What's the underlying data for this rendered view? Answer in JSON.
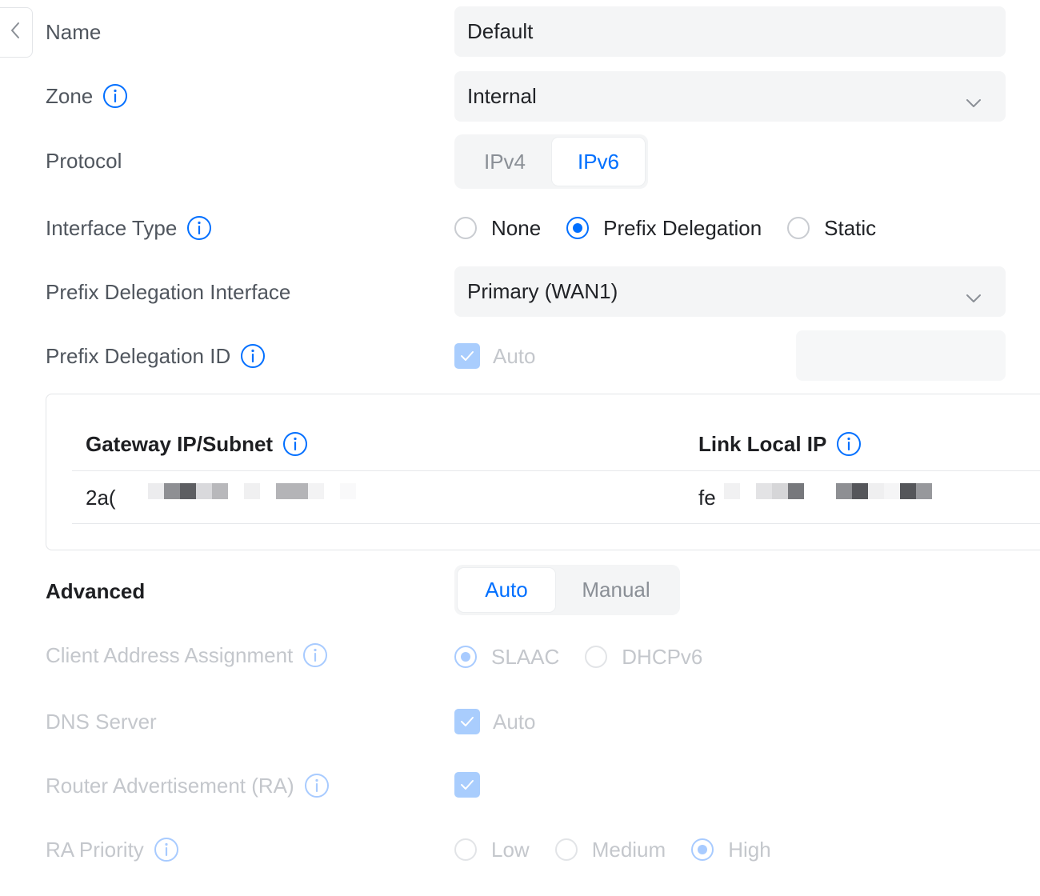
{
  "form": {
    "name_label": "Name",
    "name_value": "Default",
    "zone_label": "Zone",
    "zone_value": "Internal",
    "protocol_label": "Protocol",
    "protocol_options": [
      "IPv4",
      "IPv6"
    ],
    "protocol_selected": "IPv6",
    "interface_type_label": "Interface Type",
    "interface_type_options": [
      "None",
      "Prefix Delegation",
      "Static"
    ],
    "interface_type_selected": "Prefix Delegation",
    "pd_interface_label": "Prefix Delegation Interface",
    "pd_interface_value": "Primary (WAN1)",
    "pd_id_label": "Prefix Delegation ID",
    "pd_id_auto_label": "Auto",
    "pd_id_auto_checked": true,
    "pd_id_value": ""
  },
  "table": {
    "col_gateway": "Gateway IP/Subnet",
    "col_link_local": "Link Local IP",
    "gateway_value": "2a(",
    "link_local_value": "fe"
  },
  "advanced": {
    "label": "Advanced",
    "mode_options": [
      "Auto",
      "Manual"
    ],
    "mode_selected": "Auto",
    "client_assignment_label": "Client Address Assignment",
    "client_assignment_options": [
      "SLAAC",
      "DHCPv6"
    ],
    "client_assignment_selected": "SLAAC",
    "dns_label": "DNS Server",
    "dns_auto_label": "Auto",
    "dns_auto_checked": true,
    "ra_label": "Router Advertisement (RA)",
    "ra_checked": true,
    "ra_priority_label": "RA Priority",
    "ra_priority_options": [
      "Low",
      "Medium",
      "High"
    ],
    "ra_priority_selected": "High"
  },
  "colors": {
    "accent": "#006fff",
    "label": "#50565e",
    "disabled": "#c4c7cc",
    "field_bg": "#f4f5f6"
  },
  "icons": {
    "back": "chevron-left-icon",
    "info": "info-circle-icon",
    "dropdown": "chevron-down-icon",
    "check": "checkmark-icon"
  }
}
